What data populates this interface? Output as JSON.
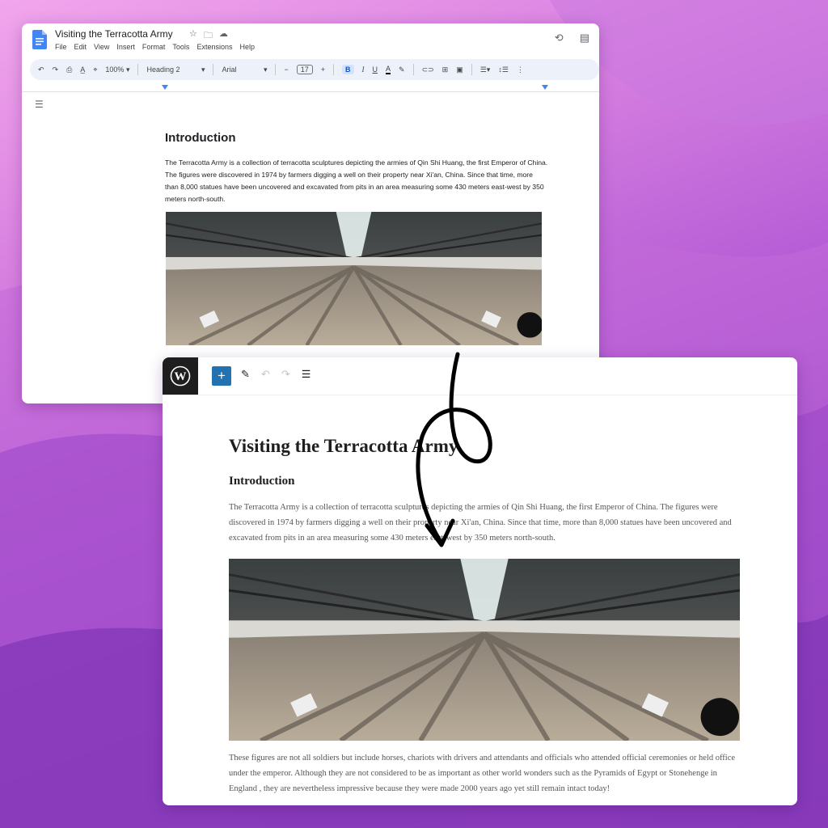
{
  "gdocs": {
    "title": "Visiting the Terracotta Army",
    "title_icons": [
      "star-icon",
      "folder-move-icon",
      "cloud-status-icon"
    ],
    "menu": [
      "File",
      "Edit",
      "View",
      "Insert",
      "Format",
      "Tools",
      "Extensions",
      "Help"
    ],
    "toolbar": {
      "zoom": "100%",
      "style": "Heading 2",
      "font": "Arial",
      "size": "17",
      "minus": "−",
      "plus": "+",
      "bold": "B",
      "italic": "I",
      "underline": "U",
      "text_color": "A"
    },
    "heading": "Introduction",
    "paragraph": "The Terracotta Army is a collection of terracotta sculptures depicting the armies of Qin Shi Huang, the first Emperor of China. The figures were discovered in 1974 by farmers digging a well on their property near Xi'an, China. Since that time, more than 8,000 statues have been uncovered and excavated from pits in an area measuring some 430 meters east-west by 350 meters north-south."
  },
  "wp": {
    "add_label": "+",
    "title": "Visiting the Terracotta Army",
    "heading": "Introduction",
    "paragraph1": "The Terracotta Army is a collection of terracotta sculptures depicting the armies of Qin Shi Huang, the first Emperor of China. The figures were discovered in 1974 by farmers digging a well on their property near Xi'an, China. Since that time, more than 8,000 statues have been uncovered and excavated from pits in an area measuring some 430 meters east-west by 350 meters north-south.",
    "paragraph2": "These figures are not all soldiers but include horses, chariots with drivers and attendants and officials who attended official ceremonies or held office under the emperor. Although they are not considered to be as important as other world wonders such as the Pyramids of Egypt or Stonehenge in England , they are nevertheless impressive because they were made 2000 years ago yet still remain intact today!"
  },
  "colors": {
    "docs_blue": "#4285f4",
    "wp_dark": "#1e1e1e",
    "wp_blue": "#2271b1",
    "background": "#b45bd6"
  }
}
